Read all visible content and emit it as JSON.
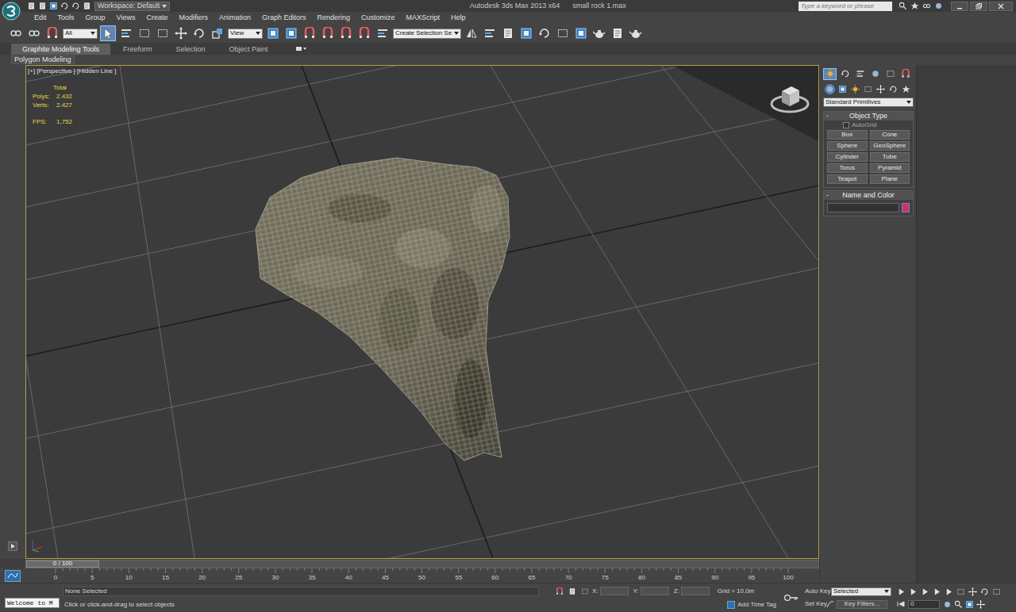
{
  "window": {
    "title": "Autodesk 3ds Max 2013 x64",
    "file": "small rock 1.max",
    "workspace": "Workspace: Default",
    "search": {
      "placeholder": "Type a keyword or phrase"
    }
  },
  "menu": [
    "Edit",
    "Tools",
    "Group",
    "Views",
    "Create",
    "Modifiers",
    "Animation",
    "Graph Editors",
    "Rendering",
    "Customize",
    "MAXScript",
    "Help"
  ],
  "toolbar": {
    "selection_filter": "All",
    "reference_coordinate": "View",
    "named_selection": "Create Selection Se"
  },
  "ribbon": {
    "tabs": [
      {
        "label": "Graphite Modeling Tools",
        "selected": true
      },
      {
        "label": "Freeform",
        "selected": false
      },
      {
        "label": "Selection",
        "selected": false
      },
      {
        "label": "Object Paint",
        "selected": false
      }
    ],
    "panel": "Polygon Modeling"
  },
  "viewport": {
    "label": "[+] [Perspective ] [Hidden Line ]",
    "active": true,
    "stats": {
      "header": "Total",
      "rows": [
        {
          "label": "Polys:",
          "value": "2.432"
        },
        {
          "label": "Verts:",
          "value": "2.427"
        },
        {
          "label": "FPS:",
          "value": "1,752"
        }
      ]
    }
  },
  "command_panel": {
    "tabs": [
      {
        "selected": true
      },
      {
        "selected": false
      },
      {
        "selected": false
      },
      {
        "selected": false
      },
      {
        "selected": false
      },
      {
        "selected": false
      }
    ],
    "category": "Standard Primitives",
    "object_type": {
      "toggle": "-",
      "title": "Object Type",
      "autogrid": {
        "label": "AutoGrid",
        "checked": false
      },
      "buttons": [
        "Box",
        "Cone",
        "Sphere",
        "GeoSphere",
        "Cylinder",
        "Tube",
        "Torus",
        "Pyramid",
        "Teapot",
        "Plane"
      ]
    },
    "name_and_color": {
      "toggle": "-",
      "title": "Name and Color",
      "color": "#c8307a"
    }
  },
  "time_slider": {
    "label": "0 / 100",
    "level": 0
  },
  "track_bar": {
    "ticks": [
      "0",
      "5",
      "10",
      "15",
      "20",
      "25",
      "30",
      "35",
      "40",
      "45",
      "50",
      "55",
      "60",
      "65",
      "70",
      "75",
      "80",
      "85",
      "90",
      "95",
      "100"
    ]
  },
  "status": {
    "maxscript": "Welcome to M",
    "selection": "None Selected",
    "prompt": "Click or click-and-drag to select objects",
    "coords": [
      "X:",
      "Y:",
      "Z:"
    ],
    "grid": "Grid = 10,0m",
    "add_time_tag": "Add Time Tag",
    "auto_key": "Auto Key",
    "key_mode": "Selected",
    "set_key": "Set Key",
    "key_filters": "Key Filters...",
    "frame": "0"
  }
}
